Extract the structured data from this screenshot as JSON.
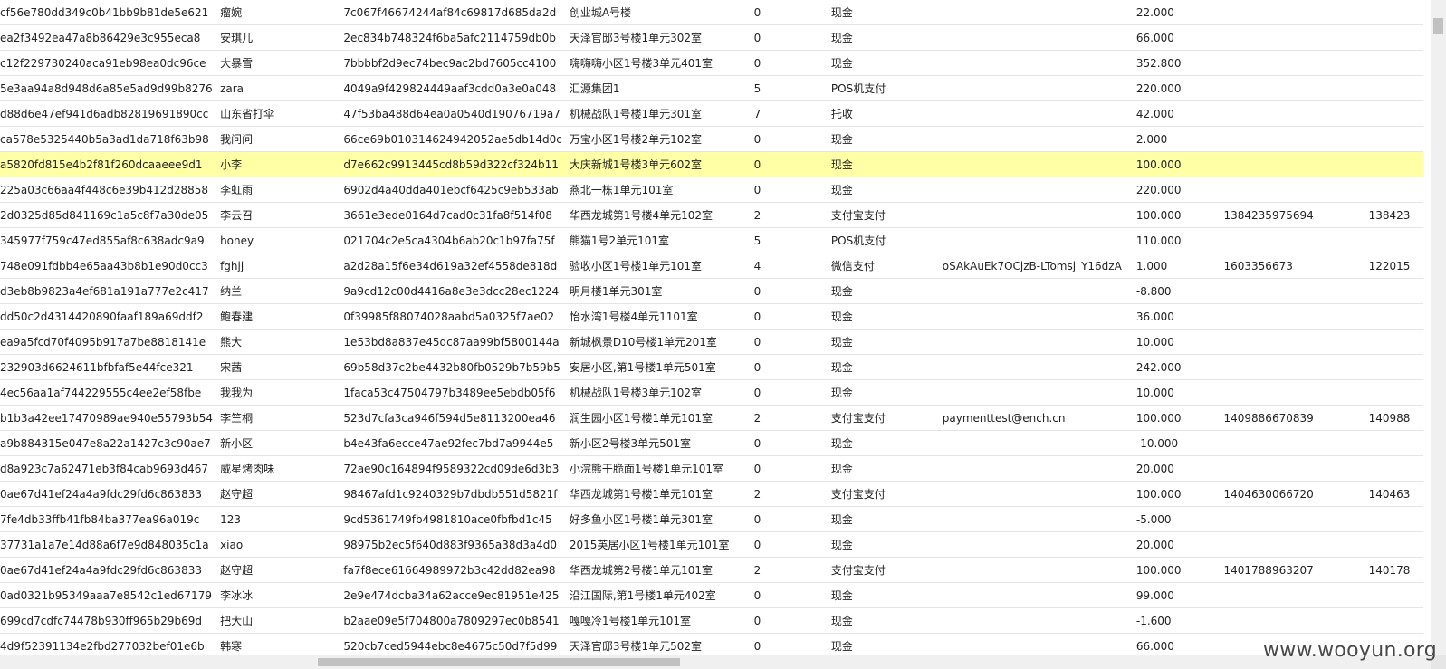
{
  "rows": [
    {
      "id": "cf56e780dd349c0b41bb9b81de5e621",
      "name": "瘤婉",
      "token": "7c067f46674244af84c69817d685da2d",
      "address": "创业城A号楼",
      "flag": "0",
      "payment": "现金",
      "account": "",
      "amount": "22.000",
      "trade_no": "",
      "extra": ""
    },
    {
      "id": "ea2f3492ea47a8b86429e3c955eca8",
      "name": "安琪儿",
      "token": "2ec834b748324f6ba5afc2114759db0b",
      "address": "天泽官邸3号楼1单元302室",
      "flag": "0",
      "payment": "现金",
      "account": "",
      "amount": "66.000",
      "trade_no": "",
      "extra": ""
    },
    {
      "id": "c12f229730240aca91eb98ea0dc96ce",
      "name": "大暴雪",
      "token": "7bbbbf2d9ec74bec9ac2bd7605cc4100",
      "address": "嗨嗨嗨小区1号楼3单元401室",
      "flag": "0",
      "payment": "现金",
      "account": "",
      "amount": "352.800",
      "trade_no": "",
      "extra": ""
    },
    {
      "id": "5e3aa94a8d948d6a85e5ad9d99b8276",
      "name": "zara",
      "token": "4049a9f429824449aaf3cdd0a3e0a048",
      "address": "汇源集团1",
      "flag": "5",
      "payment": "POS机支付",
      "account": "",
      "amount": "220.000",
      "trade_no": "",
      "extra": ""
    },
    {
      "id": "d88d6e47ef941d6adb82819691890cc",
      "name": "山东省打伞",
      "token": "47f53ba488d64ea0a0540d19076719a7",
      "address": "机械战队1号楼1单元301室",
      "flag": "7",
      "payment": "托收",
      "account": "",
      "amount": "42.000",
      "trade_no": "",
      "extra": ""
    },
    {
      "id": "ca578e5325440b5a3ad1da718f63b98",
      "name": "我问问",
      "token": "66ce69b010314624942052ae5db14d0c",
      "address": "万宝小区1号楼2单元102室",
      "flag": "0",
      "payment": "现金",
      "account": "",
      "amount": "2.000",
      "trade_no": "",
      "extra": ""
    },
    {
      "id": "a5820fd815e4b2f81f260dcaaeee9d1",
      "name": "小李",
      "token": "d7e662c9913445cd8b59d322cf324b11",
      "address": "大庆新城1号楼3单元602室",
      "flag": "0",
      "payment": "现金",
      "account": "",
      "amount": "100.000",
      "trade_no": "",
      "extra": "",
      "selected": true
    },
    {
      "id": "225a03c66aa4f448c6e39b412d28858",
      "name": "李虹雨",
      "token": "6902d4a40dda401ebcf6425c9eb533ab",
      "address": "燕北一栋1单元101室",
      "flag": "0",
      "payment": "现金",
      "account": "",
      "amount": "220.000",
      "trade_no": "",
      "extra": ""
    },
    {
      "id": "2d0325d85d841169c1a5c8f7a30de05",
      "name": "李云召",
      "token": "3661e3ede0164d7cad0c31fa8f514f08",
      "address": "华西龙城第1号楼4单元102室",
      "flag": "2",
      "payment": "支付宝支付",
      "account": "",
      "amount": "100.000",
      "trade_no": "1384235975694",
      "extra": "138423"
    },
    {
      "id": "345977f759c47ed855af8c638adc9a9",
      "name": "honey",
      "token": "021704c2e5ca4304b6ab20c1b97fa75f",
      "address": "熊猫1号2单元101室",
      "flag": "5",
      "payment": "POS机支付",
      "account": "",
      "amount": "110.000",
      "trade_no": "",
      "extra": ""
    },
    {
      "id": "748e091fdbb4e65aa43b8b1e90d0cc3",
      "name": "fghjj",
      "token": "a2d28a15f6e34d619a32ef4558de818d",
      "address": "验收小区1号楼1单元101室",
      "flag": "4",
      "payment": "微信支付",
      "account": "oSAkAuEk7OCjzB-LTomsj_Y16dzA",
      "amount": "1.000",
      "trade_no": "1603356673",
      "extra": "122015"
    },
    {
      "id": "d3eb8b9823a4ef681a191a777e2c417",
      "name": "纳兰",
      "token": "9a9cd12c00d4416a8e3e3dcc28ec1224",
      "address": "明月楼1单元301室",
      "flag": "0",
      "payment": "现金",
      "account": "",
      "amount": "-8.800",
      "trade_no": "",
      "extra": ""
    },
    {
      "id": "dd50c2d4314420890faaf189a69ddf2",
      "name": "鲍春建",
      "token": "0f39985f88074028aabd5a0325f7ae02",
      "address": "怡水湾1号楼4单元1101室",
      "flag": "0",
      "payment": "现金",
      "account": "",
      "amount": "36.000",
      "trade_no": "",
      "extra": ""
    },
    {
      "id": "ea9a5fcd70f4095b917a7be8818141e",
      "name": "熊大",
      "token": "1e53bd8a837e45dc87aa99bf5800144a",
      "address": "新城枫景D10号楼1单元201室",
      "flag": "0",
      "payment": "现金",
      "account": "",
      "amount": "10.000",
      "trade_no": "",
      "extra": ""
    },
    {
      "id": "232903d6624611bfbfaf5e44fce321",
      "name": "宋茜",
      "token": "69b58d37c2be4432b80fb0529b7b59b5",
      "address": "安居小区,第1号楼1单元501室",
      "flag": "0",
      "payment": "现金",
      "account": "",
      "amount": "242.000",
      "trade_no": "",
      "extra": ""
    },
    {
      "id": "4ec56aa1af744229555c4ee2ef58fbe",
      "name": "我我为",
      "token": "1faca53c47504797b3489ee5ebdb05f6",
      "address": "机械战队1号楼3单元102室",
      "flag": "0",
      "payment": "现金",
      "account": "",
      "amount": "10.000",
      "trade_no": "",
      "extra": ""
    },
    {
      "id": "b1b3a42ee17470989ae940e55793b54",
      "name": "李竺桐",
      "token": "523d7cfa3ca946f594d5e8113200ea46",
      "address": "润生园小区1号楼1单元101室",
      "flag": "2",
      "payment": "支付宝支付",
      "account": "paymenttest@ench.cn",
      "amount": "100.000",
      "trade_no": "1409886670839",
      "extra": "140988"
    },
    {
      "id": "a9b884315e047e8a22a1427c3c90ae7",
      "name": "新小区",
      "token": "b4e43fa6ecce47ae92fec7bd7a9944e5",
      "address": "新小区2号楼3单元501室",
      "flag": "0",
      "payment": "现金",
      "account": "",
      "amount": "-10.000",
      "trade_no": "",
      "extra": ""
    },
    {
      "id": "d8a923c7a62471eb3f84cab9693d467",
      "name": "威星烤肉味",
      "token": "72ae90c164894f9589322cd09de6d3b3",
      "address": "小浣熊干脆面1号楼1单元101室",
      "flag": "0",
      "payment": "现金",
      "account": "",
      "amount": "20.000",
      "trade_no": "",
      "extra": ""
    },
    {
      "id": "0ae67d41ef24a4a9fdc29fd6c863833",
      "name": "赵守超",
      "token": "98467afd1c9240329b7dbdb551d5821f",
      "address": "华西龙城第1号楼1单元101室",
      "flag": "2",
      "payment": "支付宝支付",
      "account": "",
      "amount": "100.000",
      "trade_no": "1404630066720",
      "extra": "140463"
    },
    {
      "id": "7fe4db33ffb41fb84ba377ea96a019c",
      "name": "123",
      "token": "9cd5361749fb4981810ace0fbfbd1c45",
      "address": "好多鱼小区1号楼1单元301室",
      "flag": "0",
      "payment": "现金",
      "account": "",
      "amount": "-5.000",
      "trade_no": "",
      "extra": ""
    },
    {
      "id": "37731a1a7e14d88a6f7e9d848035c1a",
      "name": "xiao",
      "token": "98975b2ec5f640d883f9365a38d3a4d0",
      "address": "2015英居小区1号楼1单元101室",
      "flag": "0",
      "payment": "现金",
      "account": "",
      "amount": "20.000",
      "trade_no": "",
      "extra": ""
    },
    {
      "id": "0ae67d41ef24a4a9fdc29fd6c863833",
      "name": "赵守超",
      "token": "fa7f8ece61664989972b3c42dd82ea98",
      "address": "华西龙城第2号楼1单元101室",
      "flag": "2",
      "payment": "支付宝支付",
      "account": "",
      "amount": "100.000",
      "trade_no": "1401788963207",
      "extra": "140178"
    },
    {
      "id": "0ad0321b95349aaa7e8542c1ed67179",
      "name": "李冰冰",
      "token": "2e9e474dcba34a62acce9ec81951e425",
      "address": "沿江国际,第1号楼1单元402室",
      "flag": "0",
      "payment": "现金",
      "account": "",
      "amount": "99.000",
      "trade_no": "",
      "extra": ""
    },
    {
      "id": "699cd7cdfc74478b930ff965b29b69d",
      "name": "把大山",
      "token": "b2aae09e5f704800a7809297ec0b8541",
      "address": "嘎嘎冷1号楼1单元101室",
      "flag": "0",
      "payment": "现金",
      "account": "",
      "amount": "-1.600",
      "trade_no": "",
      "extra": ""
    },
    {
      "id": "4d9f52391134e2fbd277032bef01e6b",
      "name": "韩寒",
      "token": "520cb7ced5944ebc8e4675c50d7f5d99",
      "address": "天泽官邸3号楼1单元502室",
      "flag": "0",
      "payment": "现金",
      "account": "",
      "amount": "66.000",
      "trade_no": "",
      "extra": ""
    }
  ],
  "watermark": "www.wooyun.org"
}
